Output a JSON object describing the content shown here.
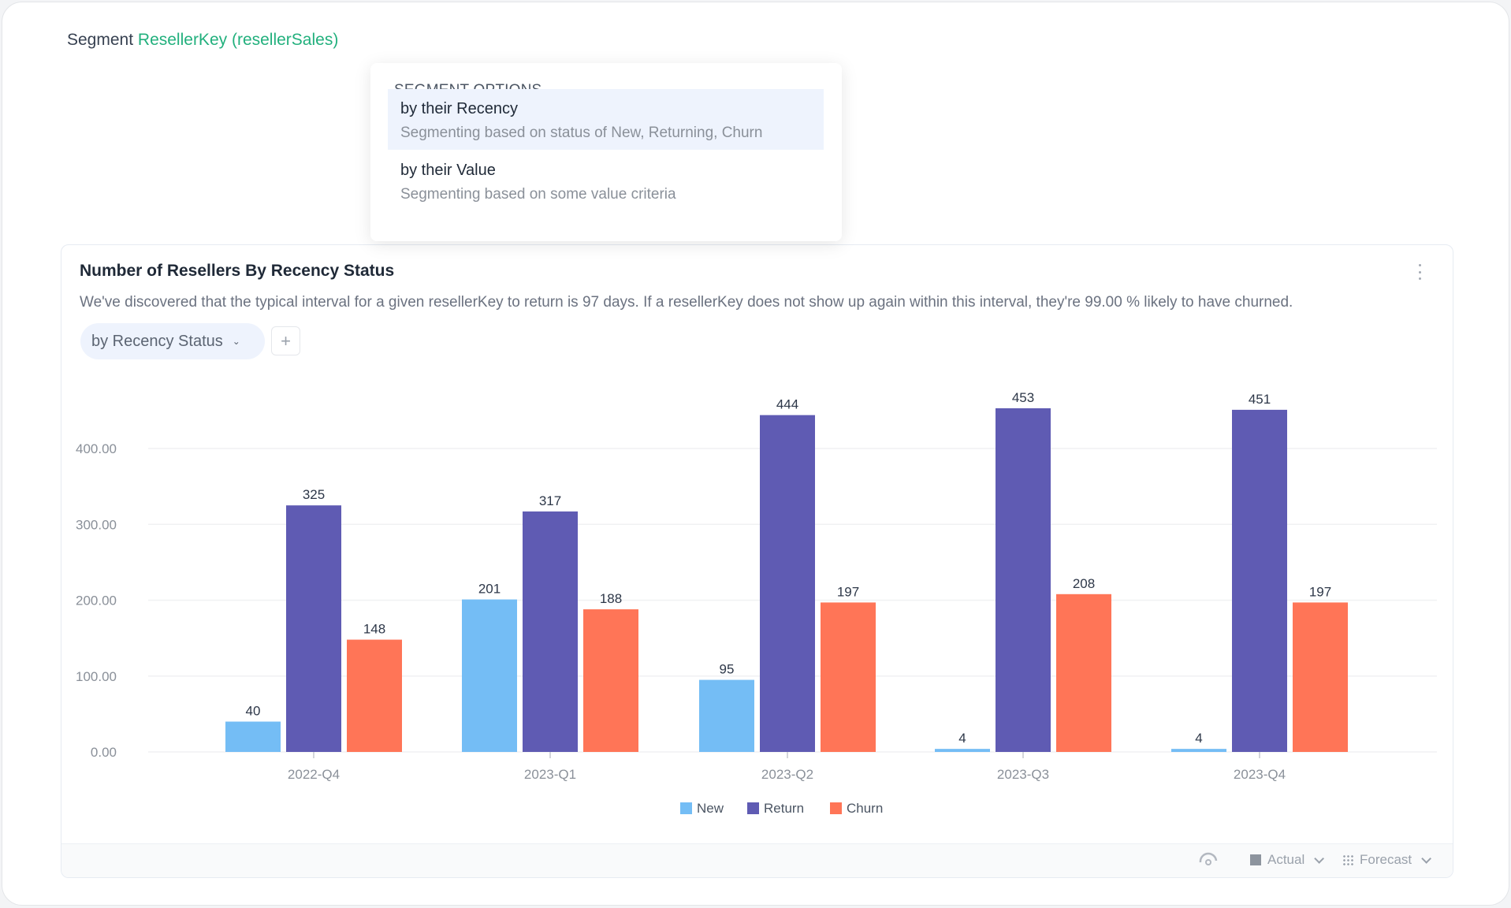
{
  "segment": {
    "prefix": "Segment",
    "key": "ResellerKey (resellerSales)"
  },
  "dropdown": {
    "title": "SEGMENT OPTIONS",
    "options": [
      {
        "label": "by their Recency",
        "description": "Segmenting based on status of New, Returning, Churn",
        "active": true
      },
      {
        "label": "by their Value",
        "description": "Segmenting based on some value criteria",
        "active": false
      }
    ]
  },
  "card": {
    "title": "Number of Resellers By Recency Status",
    "description": "We've discovered that the typical interval for a given resellerKey to return is 97 days. If a resellerKey does not show up again within this interval, they're 99.00 % likely to have churned.",
    "group_by_label": "by Recency Status",
    "add_label": "+",
    "footer": {
      "actual_label": "Actual",
      "forecast_label": "Forecast"
    }
  },
  "colors": {
    "accent": "#22b07d",
    "new": "#74bdf5",
    "return": "#5f5bb3",
    "churn": "#ff7557"
  },
  "chart_data": {
    "type": "bar",
    "title": "Number of Resellers By Recency Status",
    "xlabel": "",
    "ylabel": "",
    "categories": [
      "2022-Q4",
      "2023-Q1",
      "2023-Q2",
      "2023-Q3",
      "2023-Q4"
    ],
    "series": [
      {
        "name": "New",
        "color": "#74bdf5",
        "values": [
          40,
          201,
          95,
          4,
          4
        ]
      },
      {
        "name": "Return",
        "color": "#5f5bb3",
        "values": [
          325,
          317,
          444,
          453,
          451
        ]
      },
      {
        "name": "Churn",
        "color": "#ff7557",
        "values": [
          148,
          188,
          197,
          208,
          197
        ]
      }
    ],
    "yticks": [
      "0.00",
      "100.00",
      "200.00",
      "300.00",
      "400.00"
    ],
    "ytick_values": [
      0,
      100,
      200,
      300,
      400
    ],
    "ylim": [
      0,
      460
    ],
    "grid": true,
    "legend": "bottom-center",
    "data_labels": true
  }
}
